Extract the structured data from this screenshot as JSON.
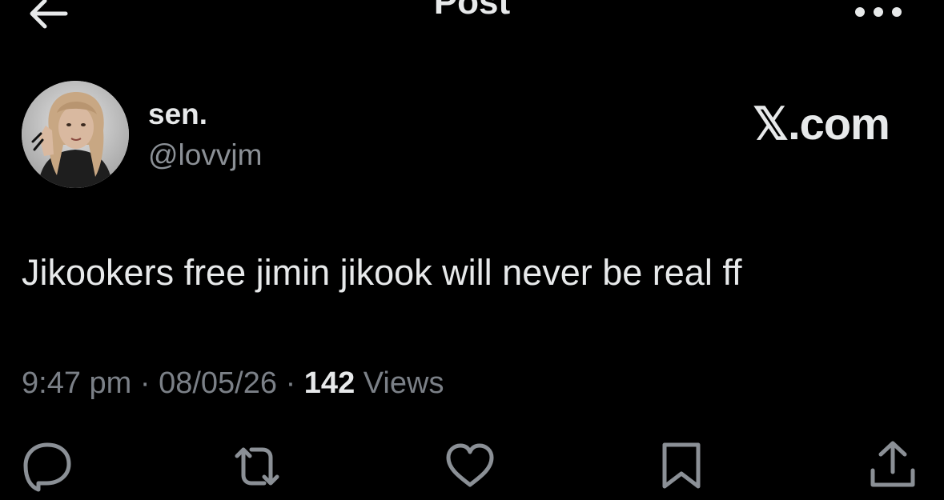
{
  "header": {
    "title": "Post",
    "back_icon": "arrow-left-icon",
    "more_icon": "more-horizontal-icon"
  },
  "author": {
    "display_name": "sen.",
    "handle": "@lovvjm",
    "avatar_icon": "profile-photo"
  },
  "watermark": "𝕏.com",
  "post": {
    "text": "Jikookers free jimin jikook will never be real ff"
  },
  "meta": {
    "time": "9:47 pm",
    "separator": "·",
    "date": "08/05/26",
    "views_count": "142",
    "views_label": "Views"
  },
  "actions": [
    {
      "icon": "reply-icon"
    },
    {
      "icon": "repost-icon"
    },
    {
      "icon": "like-icon"
    },
    {
      "icon": "bookmark-icon"
    },
    {
      "icon": "share-icon"
    }
  ],
  "colors": {
    "background": "#000000",
    "text_primary": "#e7e9ea",
    "text_secondary": "#7b8087",
    "icon": "#8b9096"
  }
}
